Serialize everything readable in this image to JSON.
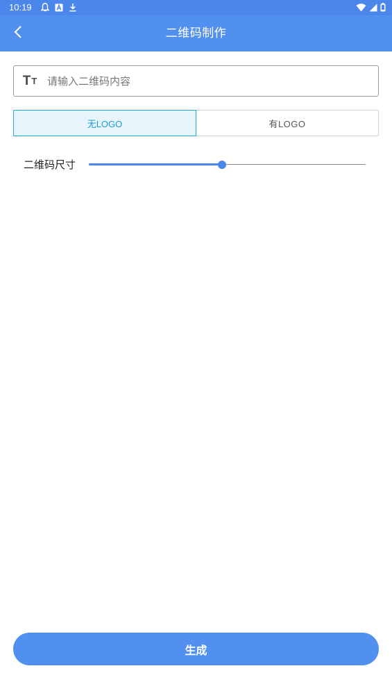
{
  "status_bar": {
    "time": "10:19",
    "left_icons": [
      "notification-bell-icon",
      "app-a-icon",
      "download-icon"
    ],
    "right_icons": [
      "wifi-icon",
      "signal-icon",
      "battery-icon"
    ]
  },
  "app_bar": {
    "title": "二维码制作",
    "back_icon": "chevron-left-icon",
    "background_color": "#5290f0"
  },
  "content_input": {
    "icon": "text-size-icon",
    "icon_text_big": "T",
    "icon_text_small": "T",
    "value": "",
    "placeholder": "请输入二维码内容"
  },
  "logo_toggle": {
    "options": [
      {
        "label": "无LOGO",
        "selected": true
      },
      {
        "label": "有LOGO",
        "selected": false
      }
    ],
    "selected_color": "#1a9fd6"
  },
  "size_setting": {
    "label": "二维码尺寸",
    "value_fraction": 0.48
  },
  "generate_button": {
    "label": "生成",
    "color": "#5290f0"
  }
}
